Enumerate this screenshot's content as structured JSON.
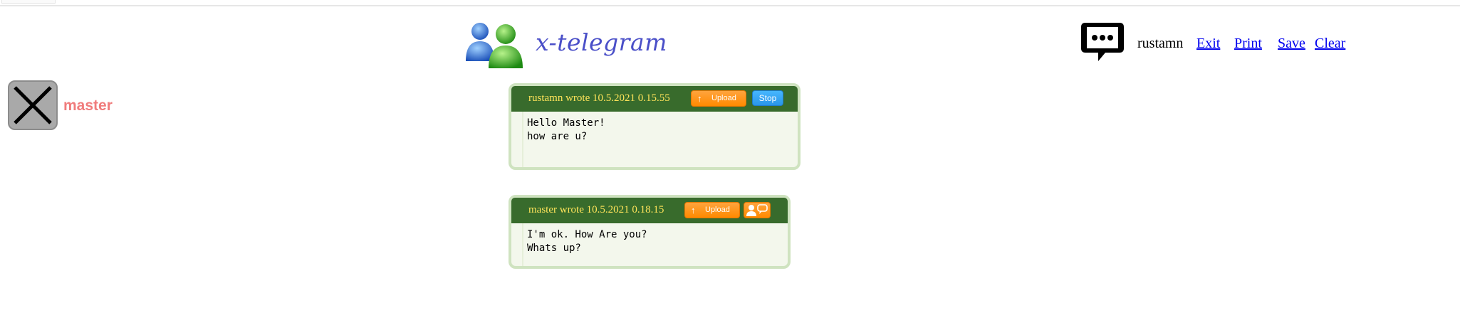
{
  "brand": {
    "title": "x-telegram",
    "icon": "users-icon"
  },
  "header": {
    "chat_icon": "chat-bubble-icon",
    "username": "rustamn",
    "links": {
      "exit": "Exit",
      "print": "Print",
      "save": "Save",
      "clear": "Clear"
    }
  },
  "contact": {
    "name": "master",
    "avatar_icon": "close-x-icon"
  },
  "messages": [
    {
      "header": "rustamn wrote 10.5.2021 0.15.55",
      "upload_label": "Upload",
      "stop_label": "Stop",
      "lines": [
        "Hello Master!",
        "how are u?"
      ]
    },
    {
      "header": "master wrote 10.5.2021 0.18.15",
      "upload_label": "Upload",
      "contact_icon": "user-chat-icon",
      "lines": [
        "I'm ok. How Are you?",
        "Whats up?"
      ]
    }
  ],
  "colors": {
    "message_header_bg": "#386b2c",
    "message_header_text": "#ffe45a",
    "message_border": "#cfe3c0",
    "upload_button": "#ff8a00",
    "stop_button": "#2a96e8",
    "contact_name": "#f07c7c",
    "brand_title": "#4a4fc8",
    "link": "#0000ee"
  }
}
